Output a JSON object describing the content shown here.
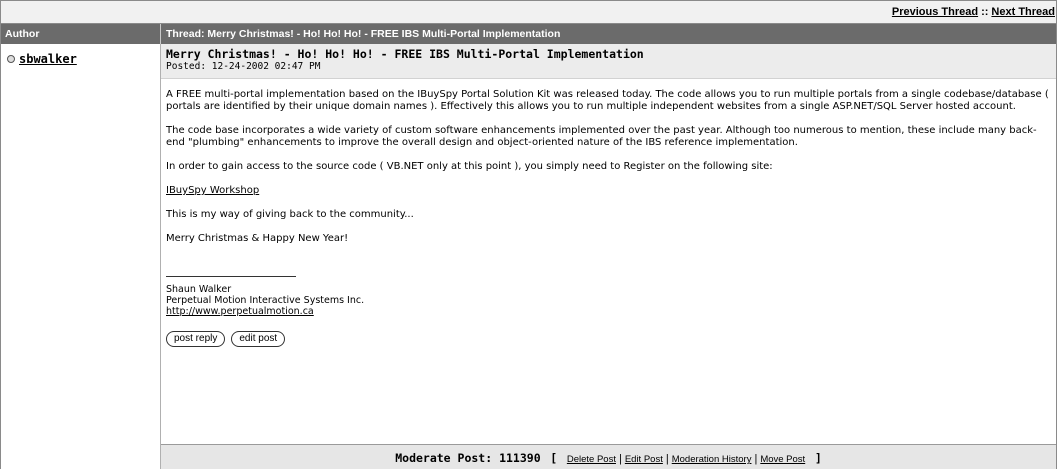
{
  "topnav": {
    "previous_label": "Previous Thread",
    "separator": "::",
    "next_label": "Next Thread"
  },
  "header": {
    "author_col": "Author",
    "thread_title": "Thread: Merry Christmas! - Ho! Ho! Ho! - FREE IBS Multi-Portal Implementation"
  },
  "post": {
    "author": "sbwalker",
    "subject": "Merry Christmas! - Ho! Ho! Ho! - FREE IBS Multi-Portal Implementation",
    "posted": "Posted: 12-24-2002 02:47 PM",
    "paragraphs": [
      "A FREE multi-portal implementation based on the IBuySpy Portal Solution Kit was released today. The code allows you to run multiple portals from a single codebase/database ( portals are identified by their unique domain names ). Effectively this allows you to run multiple independent websites from a single ASP.NET/SQL Server hosted account.",
      "The code base incorporates a wide variety of custom software enhancements implemented over the past year. Although too numerous to mention, these include many back-end \"plumbing\" enhancements to improve the overall design and object-oriented nature of the IBS reference implementation.",
      "In order to gain access to the source code ( VB.NET only at this point ), you simply need to Register on the following site:"
    ],
    "link_text": "IBuySpy Workshop",
    "closing": [
      "This is my way of giving back to the community...",
      "Merry Christmas & Happy New Year!"
    ],
    "signature": {
      "name": "Shaun Walker",
      "company": "Perpetual Motion Interactive Systems Inc.",
      "url": "http://www.perpetualmotion.ca"
    },
    "buttons": {
      "reply": "post reply",
      "edit": "edit post"
    }
  },
  "moderate": {
    "title": "Moderate Post: 111390",
    "open": "[",
    "close": "]",
    "links": [
      "Delete Post",
      "Edit Post",
      "Moderation History",
      "Move Post"
    ],
    "separator": "|"
  }
}
